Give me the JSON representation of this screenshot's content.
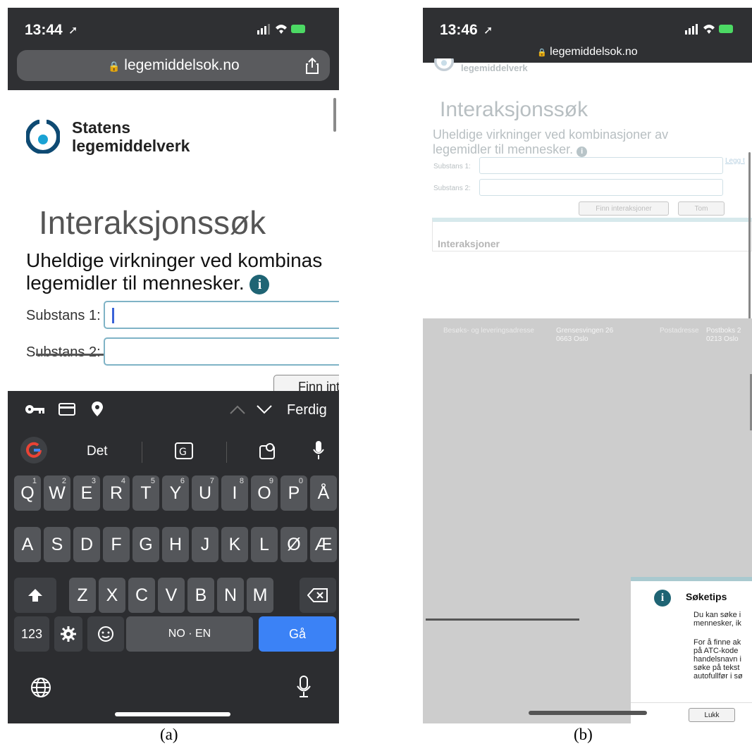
{
  "phone_a": {
    "time": "13:44",
    "url": "legemiddelsok.no",
    "logo_line1": "Statens",
    "logo_line2": "legemiddelverk",
    "title": "Interaksjonssøk",
    "subtitle_line1": "Uheldige virkninger ved kombinas",
    "subtitle_line2": "legemidler til mennesker.",
    "substans1_label": "Substans 1:",
    "substans2_label": "Substans 2:",
    "finn_button": "Finn int",
    "kb_done": "Ferdig",
    "suggestion": "Det",
    "row1": [
      {
        "k": "Q",
        "n": "1"
      },
      {
        "k": "W",
        "n": "2"
      },
      {
        "k": "E",
        "n": "3"
      },
      {
        "k": "R",
        "n": "4"
      },
      {
        "k": "T",
        "n": "5"
      },
      {
        "k": "Y",
        "n": "6"
      },
      {
        "k": "U",
        "n": "7"
      },
      {
        "k": "I",
        "n": "8"
      },
      {
        "k": "O",
        "n": "9"
      },
      {
        "k": "P",
        "n": "0"
      },
      {
        "k": "Å",
        "n": ""
      }
    ],
    "row2": [
      "A",
      "S",
      "D",
      "F",
      "G",
      "H",
      "J",
      "K",
      "L",
      "Ø",
      "Æ"
    ],
    "row3": [
      "Z",
      "X",
      "C",
      "V",
      "B",
      "N",
      "M"
    ],
    "numbers_key": "123",
    "space_key": "NO · EN",
    "go_key": "Gå"
  },
  "phone_b": {
    "time": "13:46",
    "url": "legemiddelsok.no",
    "logo_partial": "legemiddelverk",
    "title": "Interaksjonssøk",
    "subtitle_line1": "Uheldige virkninger ved kombinasjoner av",
    "subtitle_line2": "legemidler til mennesker.",
    "substans1_label": "Substans 1:",
    "substans2_label": "Substans 2:",
    "legg_link": "Legg t",
    "finn_button": "Finn interaksjoner",
    "tom_button": "Tom",
    "interaksjoner_header": "Interaksjoner",
    "footer_label1": "Besøks- og leveringsadresse",
    "footer_addr1_line1": "Grensesvingen 26",
    "footer_addr1_line2": "0663 Oslo",
    "footer_label2": "Postadresse",
    "footer_addr2_line1": "Postboks 2",
    "footer_addr2_line2": "0213 Oslo",
    "dialog_title": "Søketips",
    "dialog_p1_line1": "Du kan søke i",
    "dialog_p1_line2": "mennesker, ik",
    "dialog_p2_lines": [
      "For å finne ak",
      "på ATC-kode",
      "handelsnavn i",
      "søke på tekst",
      "autofullfør i sø"
    ],
    "dialog_close": "Lukk"
  },
  "captions": {
    "a": "(a)",
    "b": "(b)"
  },
  "colors": {
    "teal": "#1f6474",
    "logo_blue": "#0e4a73",
    "go_blue": "#3b82f6"
  }
}
